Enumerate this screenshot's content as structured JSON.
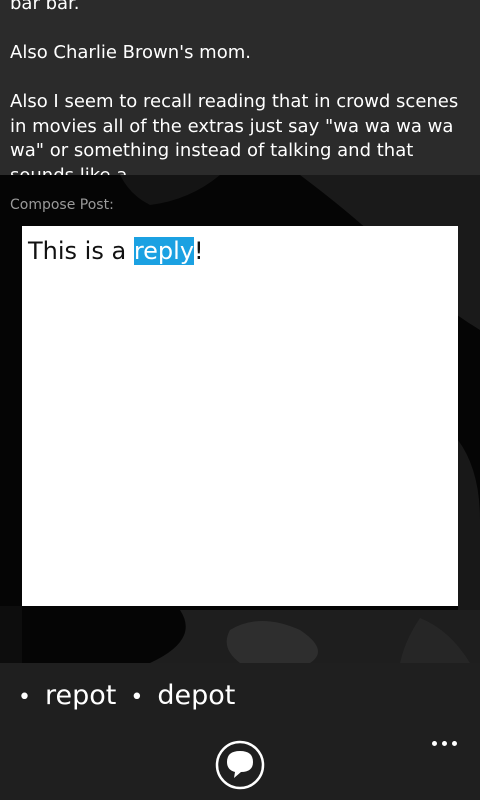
{
  "post": {
    "lines": [
      "bar bar.",
      "Also Charlie Brown's mom.",
      "Also I seem to recall reading that in crowd scenes in movies all of the extras just say \"wa wa wa wa wa\" or something instead of talking and that sounds like a"
    ]
  },
  "compose": {
    "label": "Compose Post:",
    "text_before": "This is a ",
    "text_selected": "reply",
    "text_after": "!"
  },
  "tags": {
    "bullet": "•",
    "items": [
      "repot",
      "depot"
    ]
  },
  "appbar": {
    "reply_icon": "speech-bubble-icon",
    "more_icon": "ellipsis-icon"
  },
  "colors": {
    "selection": "#1ba1e2",
    "post_background": "#2b2b2b",
    "appbar_background": "#1f1f1f"
  }
}
